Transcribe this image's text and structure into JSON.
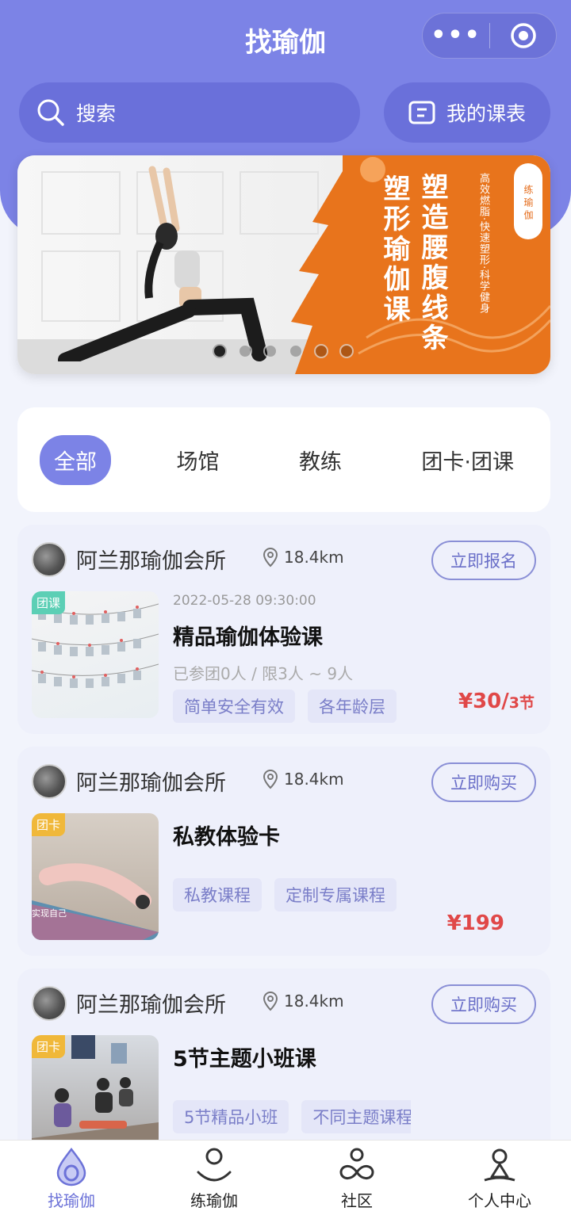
{
  "header": {
    "title": "找瑜伽",
    "capsule_dots": "•••"
  },
  "search": {
    "placeholder": "搜索"
  },
  "schedule": {
    "label": "我的课表"
  },
  "banner": {
    "title_right": "塑造腰腹线条",
    "title_left": "塑形瑜伽课",
    "subtitle": "高效燃脂·快速塑形·科学健身",
    "tag": "练瑜伽",
    "dot_count": 6,
    "active_dot": 0
  },
  "filters": [
    {
      "label": "全部",
      "active": true
    },
    {
      "label": "场馆",
      "active": false
    },
    {
      "label": "教练",
      "active": false
    },
    {
      "label": "团卡·团课",
      "active": false
    }
  ],
  "cards": [
    {
      "venue": "阿兰那瑜伽会所",
      "distance": "18.4km",
      "action": "立即报名",
      "badge": "团课",
      "time": "2022-05-28 09:30:00",
      "name": "精品瑜伽体验课",
      "meta": "已参团0人 / 限3人 ~ 9人",
      "tags": [
        "简单安全有效",
        "各年龄层"
      ],
      "price": "¥30/",
      "price_unit": "3节"
    },
    {
      "venue": "阿兰那瑜伽会所",
      "distance": "18.4km",
      "action": "立即购买",
      "badge": "团卡",
      "name": "私教体验卡",
      "tags": [
        "私教课程",
        "定制专属课程"
      ],
      "price": "¥199",
      "thumb_caption": "实现自己"
    },
    {
      "venue": "阿兰那瑜伽会所",
      "distance": "18.4km",
      "action": "立即购买",
      "badge": "团卡",
      "name": "5节主题小班课",
      "tags": [
        "5节精品小班",
        "不同主题课程"
      ]
    }
  ],
  "nav": [
    {
      "label": "找瑜伽",
      "icon": "drop-icon",
      "active": true
    },
    {
      "label": "练瑜伽",
      "icon": "meditation-icon",
      "active": false
    },
    {
      "label": "社区",
      "icon": "community-icon",
      "active": false
    },
    {
      "label": "个人中心",
      "icon": "profile-icon",
      "active": false
    }
  ],
  "colors": {
    "primary": "#7c83e6",
    "accent_orange": "#e8741c",
    "price_red": "#e04848",
    "badge_green": "#5ccfb5",
    "badge_yellow": "#f0b83a"
  }
}
